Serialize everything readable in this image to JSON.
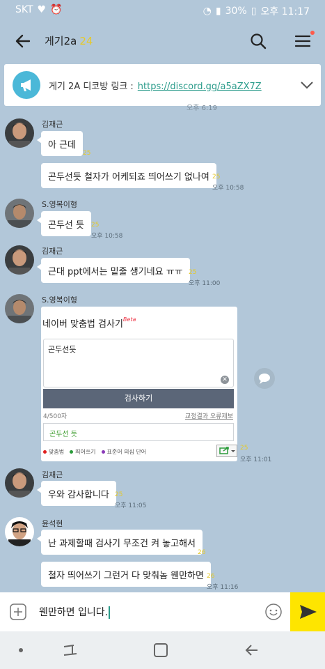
{
  "status": {
    "carrier": "SKT",
    "battery": "30%",
    "clock": "오후 11:17"
  },
  "header": {
    "title": "게기2a",
    "member_count": "24"
  },
  "notice": {
    "text": "게기 2A 디코방 링크 :",
    "link": "https://discord.gg/a5aZX7Z"
  },
  "partial_time": "오후 6:19",
  "messages": [
    {
      "sender": "김재근",
      "text": "아 근데",
      "unread": "25",
      "time": ""
    },
    {
      "sender": "",
      "text": "곤두선듯 철자가 어케되죠 띄어쓰기 없나여",
      "unread": "25",
      "time": "오후 10:58"
    },
    {
      "sender": "S.영복이형",
      "text": "곤두선 듯",
      "unread": "25",
      "time": "오후 10:58"
    },
    {
      "sender": "김재근",
      "text": "근대 ppt에서는 밑줄 생기네요 ㅠㅠ",
      "unread": "25",
      "time": "오후 11:00"
    },
    {
      "sender": "S.영복이형",
      "text": "",
      "unread": "25",
      "time": "오후 11:01"
    },
    {
      "sender": "김재근",
      "text": "우와 감사합니다",
      "unread": "25",
      "time": "오후 11:05"
    },
    {
      "sender": "윤석현",
      "text": "난 과제할때 검사기 무조건 켜 놓고해서",
      "unread": "26",
      "time": ""
    },
    {
      "sender": "",
      "text": "철자 띄어쓰기 그런거 다 맞춰놈 웬만하면",
      "unread": "26",
      "time": "오후 11:16"
    }
  ],
  "card": {
    "title": "네이버 맞춤법 검사기",
    "beta": "Beta",
    "input_value": "곤두선듯",
    "check_button": "검사하기",
    "char_count": "4/500자",
    "links": "교정결과 오류제보",
    "result": "곤두선 듯",
    "legend": [
      {
        "label": "맞춤법",
        "color": "#e02020"
      },
      {
        "label": "띄어쓰기",
        "color": "#2a9b3a"
      },
      {
        "label": "표준어 의심 단어",
        "color": "#8a3ab8"
      }
    ]
  },
  "input": {
    "value": "웬만하면 입니다."
  }
}
